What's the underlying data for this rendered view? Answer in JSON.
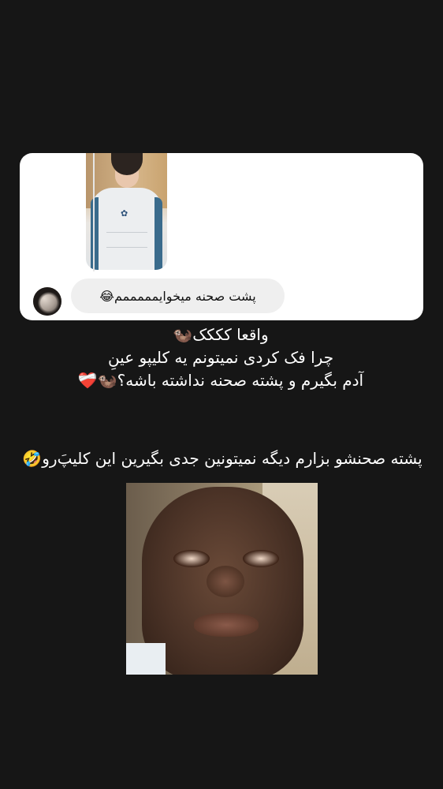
{
  "card": {
    "reply_text": "پشت صحنه میخوایمممممم",
    "reply_emoji": "😂",
    "thumb_logo_glyph": "✿"
  },
  "caption": {
    "line1": "واقعا کککک🦦",
    "line2": "چرا فک کردی نمیتونم یه کلیپو عینِ",
    "line3": "آدم بگیرم و پشته صحنه نداشته باشه؟🦦❤️‍🩹"
  },
  "second_caption": {
    "text": "پشته صحنشو بزارم دیگه نمیتونین جدی بگیرین این کلیپ‌َرو🤣"
  },
  "colors": {
    "background": "#161616",
    "card_bg": "#ffffff",
    "bubble_bg": "#efefef",
    "text": "#ffffff"
  }
}
